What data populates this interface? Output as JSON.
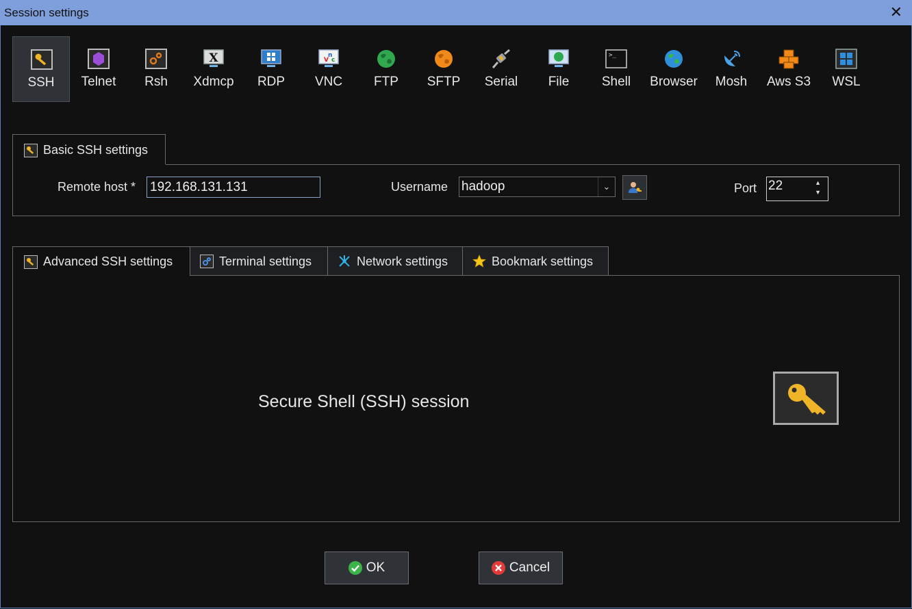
{
  "window": {
    "title": "Session settings"
  },
  "session_types": [
    {
      "label": "SSH",
      "icon": "key-icon",
      "selected": true
    },
    {
      "label": "Telnet",
      "icon": "telnet-icon"
    },
    {
      "label": "Rsh",
      "icon": "rsh-icon"
    },
    {
      "label": "Xdmcp",
      "icon": "x-monitor-icon"
    },
    {
      "label": "RDP",
      "icon": "rdp-monitor-icon"
    },
    {
      "label": "VNC",
      "icon": "vnc-monitor-icon"
    },
    {
      "label": "FTP",
      "icon": "globe-icon"
    },
    {
      "label": "SFTP",
      "icon": "orange-globe-icon"
    },
    {
      "label": "Serial",
      "icon": "serial-plug-icon"
    },
    {
      "label": "File",
      "icon": "file-monitor-icon"
    },
    {
      "label": "Shell",
      "icon": "terminal-icon"
    },
    {
      "label": "Browser",
      "icon": "browser-globe-icon"
    },
    {
      "label": "Mosh",
      "icon": "satellite-dish-icon"
    },
    {
      "label": "Aws S3",
      "icon": "cubes-icon"
    },
    {
      "label": "WSL",
      "icon": "windows-icon"
    }
  ],
  "basic_tab": {
    "label": "Basic SSH settings"
  },
  "fields": {
    "remote_host_label": "Remote host *",
    "remote_host_value": "192.168.131.131",
    "username_label": "Username",
    "username_value": "hadoop",
    "port_label": "Port",
    "port_value": "22"
  },
  "lower_tabs": [
    {
      "label": "Advanced SSH settings",
      "icon": "key-icon"
    },
    {
      "label": "Terminal settings",
      "icon": "gear-icon"
    },
    {
      "label": "Network settings",
      "icon": "network-star-icon"
    },
    {
      "label": "Bookmark settings",
      "icon": "star-icon"
    }
  ],
  "description": "Secure Shell (SSH) session",
  "buttons": {
    "ok": "OK",
    "cancel": "Cancel"
  },
  "colors": {
    "titlebar": "#7f9fdc",
    "background": "#111111",
    "ok_green": "#3cb44a",
    "cancel_red": "#e03a3a",
    "key_gold": "#f0b429"
  }
}
